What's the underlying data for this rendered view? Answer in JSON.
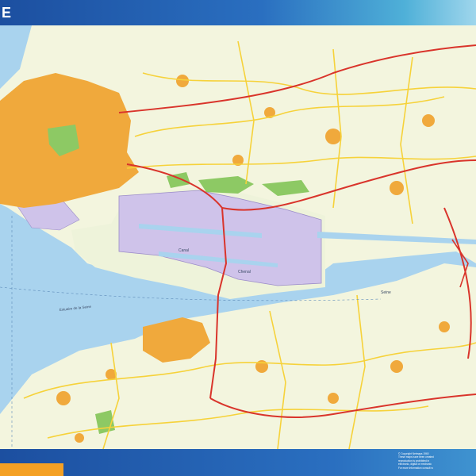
{
  "header": {
    "title": "E"
  },
  "colors": {
    "sea": "#a9d3ee",
    "land": "#f3f5de",
    "urban": "#f0a93c",
    "industrial": "#cfc3ea",
    "forest": "#8dc964",
    "road_major": "#d9342b",
    "road_secondary": "#f6d23a",
    "header_blue": "#1d4f9c",
    "accent_orange": "#f4a024"
  },
  "map": {
    "labels": {
      "river_name": "Seine",
      "river_channel": "Chenal",
      "canal": "Canal",
      "estuary": "Estuaire de la Seine"
    }
  },
  "footer": {
    "notes": [
      "© Copyright Netmaps 1960",
      "These maps have been created",
      "reproduction is prohibited in",
      "electronic, digital or mechanic",
      "For more information consult w"
    ]
  }
}
